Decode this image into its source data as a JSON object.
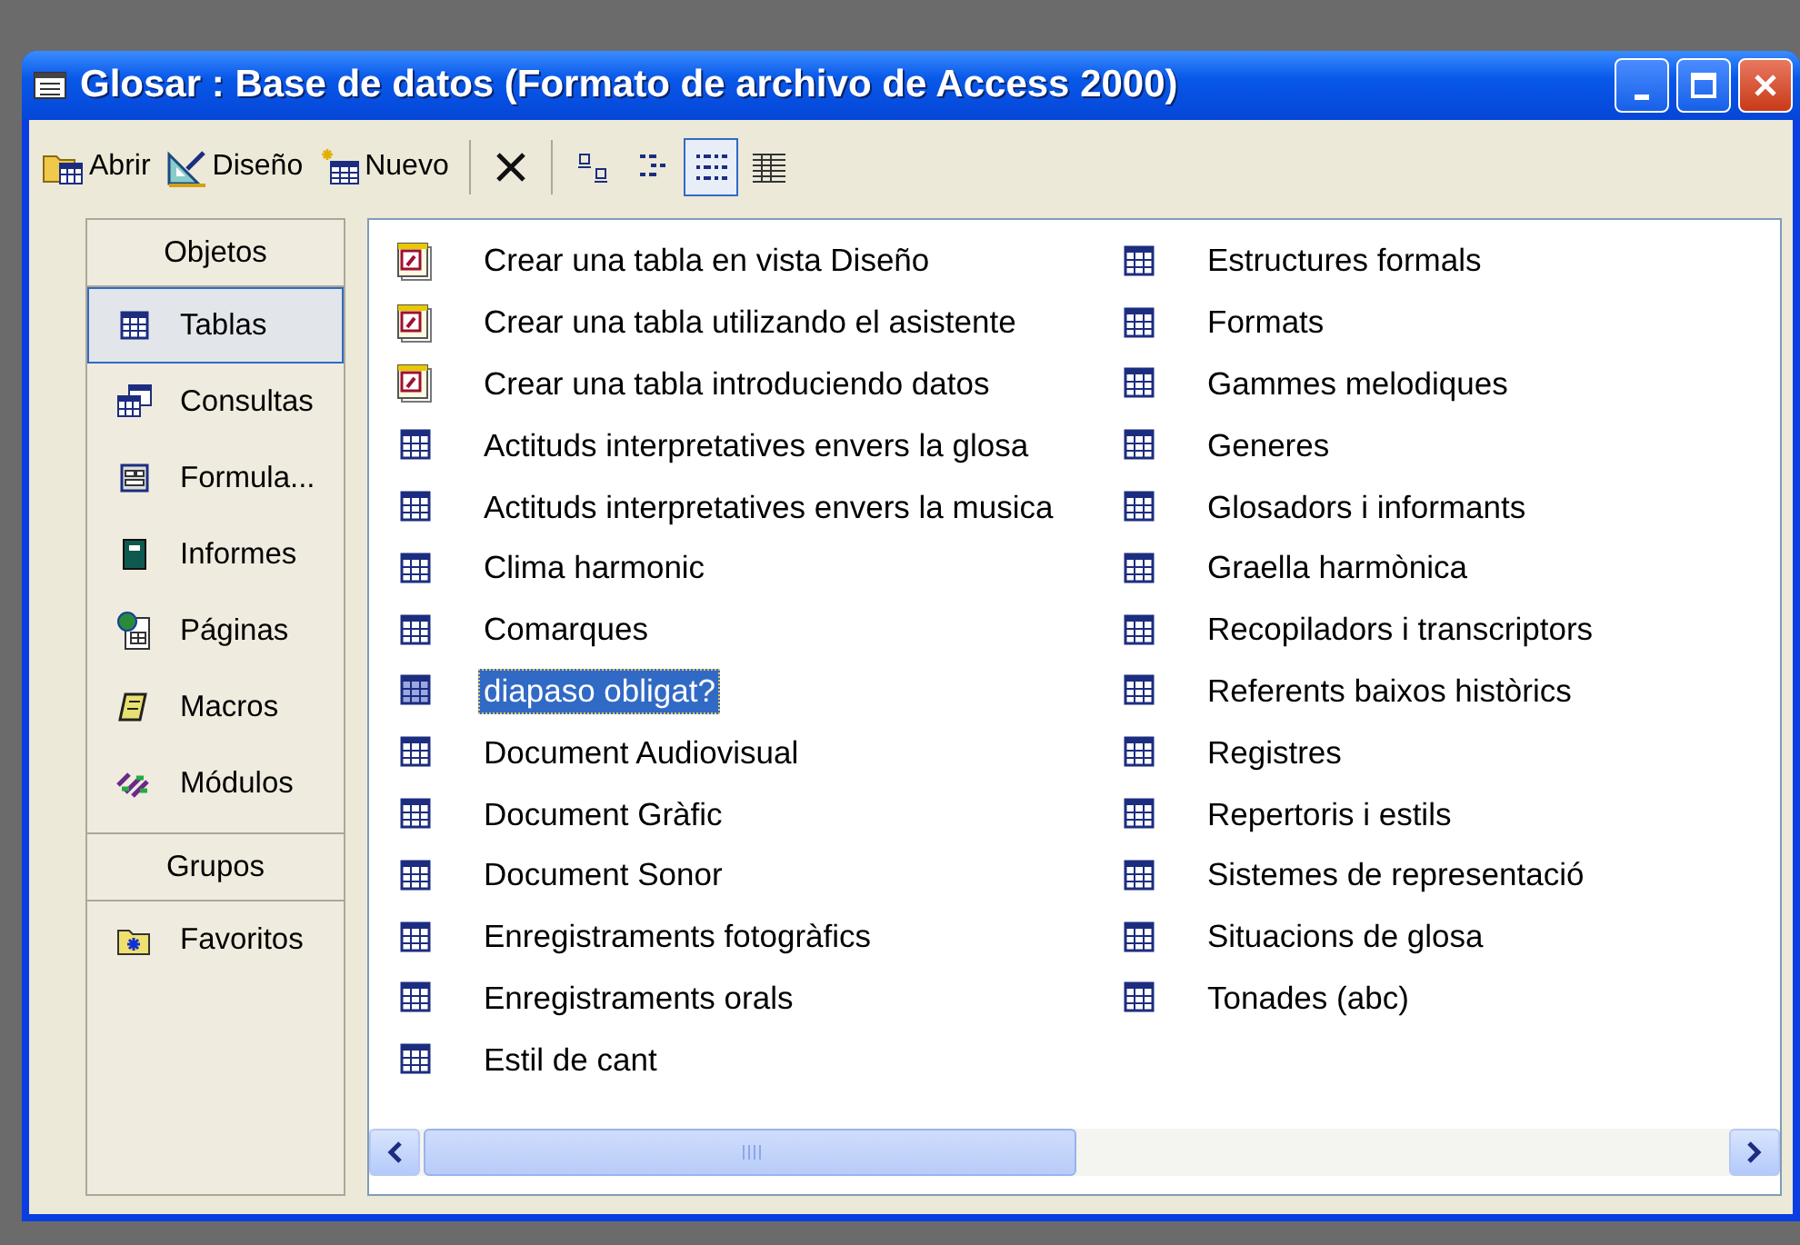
{
  "window": {
    "title": "Glosar : Base de datos (Formato de archivo de Access 2000)"
  },
  "toolbar": {
    "buttons": [
      {
        "label": "Abrir",
        "kind": "open"
      },
      {
        "label": "Diseño",
        "kind": "design"
      },
      {
        "label": "Nuevo",
        "kind": "new"
      }
    ],
    "views": [
      {
        "kind": "large-icons",
        "selected": false
      },
      {
        "kind": "small-icons",
        "selected": false
      },
      {
        "kind": "list",
        "selected": true
      },
      {
        "kind": "details",
        "selected": false
      }
    ]
  },
  "sidebar": {
    "sections": [
      {
        "header": "Objetos",
        "items": [
          {
            "label": "Tablas",
            "kind": "table",
            "selected": true
          },
          {
            "label": "Consultas",
            "kind": "query",
            "selected": false
          },
          {
            "label": "Formula...",
            "kind": "form",
            "selected": false
          },
          {
            "label": "Informes",
            "kind": "report",
            "selected": false
          },
          {
            "label": "Páginas",
            "kind": "page",
            "selected": false
          },
          {
            "label": "Macros",
            "kind": "macro",
            "selected": false
          },
          {
            "label": "Módulos",
            "kind": "module",
            "selected": false
          }
        ]
      },
      {
        "header": "Grupos",
        "items": [
          {
            "label": "Favoritos",
            "kind": "favorites",
            "selected": false
          }
        ]
      }
    ]
  },
  "list": {
    "columns": [
      [
        {
          "label": "Crear una tabla en vista Diseño",
          "kind": "wizard",
          "selected": false
        },
        {
          "label": "Crear una tabla utilizando el asistente",
          "kind": "wizard",
          "selected": false
        },
        {
          "label": "Crear una tabla introduciendo datos",
          "kind": "wizard",
          "selected": false
        },
        {
          "label": "Actituds interpretatives envers la glosa",
          "kind": "table",
          "selected": false
        },
        {
          "label": "Actituds interpretatives envers la musica",
          "kind": "table",
          "selected": false
        },
        {
          "label": "Clima harmonic",
          "kind": "table",
          "selected": false
        },
        {
          "label": "Comarques",
          "kind": "table",
          "selected": false
        },
        {
          "label": "diapaso obligat?",
          "kind": "table",
          "selected": true
        },
        {
          "label": "Document Audiovisual",
          "kind": "table",
          "selected": false
        },
        {
          "label": "Document Gràfic",
          "kind": "table",
          "selected": false
        },
        {
          "label": "Document Sonor",
          "kind": "table",
          "selected": false
        },
        {
          "label": "Enregistraments fotogràfics",
          "kind": "table",
          "selected": false
        },
        {
          "label": "Enregistraments orals",
          "kind": "table",
          "selected": false
        },
        {
          "label": "Estil de cant",
          "kind": "table",
          "selected": false
        }
      ],
      [
        {
          "label": "Estructures formals",
          "kind": "table",
          "selected": false
        },
        {
          "label": "Formats",
          "kind": "table",
          "selected": false
        },
        {
          "label": "Gammes melodiques",
          "kind": "table",
          "selected": false
        },
        {
          "label": "Generes",
          "kind": "table",
          "selected": false
        },
        {
          "label": "Glosadors i informants",
          "kind": "table",
          "selected": false
        },
        {
          "label": "Graella harmònica",
          "kind": "table",
          "selected": false
        },
        {
          "label": "Recopiladors i transcriptors",
          "kind": "table",
          "selected": false
        },
        {
          "label": "Referents baixos històrics",
          "kind": "table",
          "selected": false
        },
        {
          "label": "Registres",
          "kind": "table",
          "selected": false
        },
        {
          "label": "Repertoris i estils",
          "kind": "table",
          "selected": false
        },
        {
          "label": "Sistemes de representació",
          "kind": "table",
          "selected": false
        },
        {
          "label": "Situacions de glosa",
          "kind": "table",
          "selected": false
        },
        {
          "label": "Tonades (abc)",
          "kind": "table",
          "selected": false
        }
      ]
    ]
  }
}
